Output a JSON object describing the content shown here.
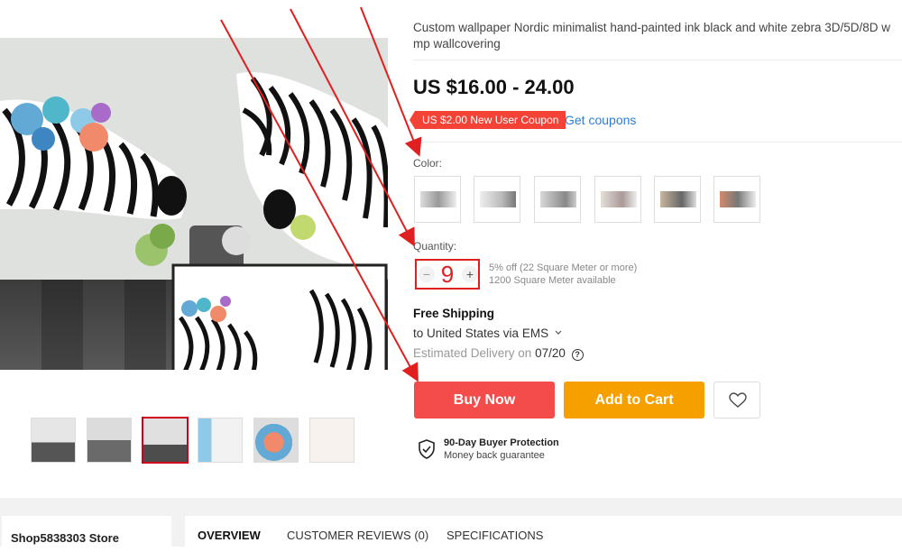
{
  "product": {
    "title_line1": "Custom wallpaper Nordic minimalist hand-painted ink black and white zebra 3D/5D/8D w",
    "title_line2": "mp wallcovering",
    "price": "US $16.00 - 24.00",
    "coupon_label": "US $2.00 New User Coupon",
    "get_coupons": "Get coupons"
  },
  "color": {
    "label": "Color:",
    "swatch_count": 6
  },
  "quantity": {
    "label": "Quantity:",
    "value": "9",
    "minus": "−",
    "plus": "+",
    "discount": "5% off (22 Square Meter or more)",
    "available": "1200 Square Meter available"
  },
  "shipping": {
    "title": "Free Shipping",
    "destination": "to United States via EMS",
    "estimate_prefix": "Estimated Delivery on",
    "estimate_date": "07/20",
    "help_glyph": "?"
  },
  "actions": {
    "buy_now": "Buy Now",
    "add_to_cart": "Add to Cart"
  },
  "protection": {
    "title": "90-Day Buyer Protection",
    "subtitle": "Money back guarantee"
  },
  "gallery": {
    "thumbnail_count": 6,
    "active_index": 2
  },
  "bottom": {
    "store_name": "Shop5838303 Store",
    "tabs": [
      "OVERVIEW",
      "CUSTOMER REVIEWS (0)",
      "SPECIFICATIONS"
    ]
  },
  "colors": {
    "accent_red": "#f44b4b",
    "accent_orange": "#f6a000",
    "link_blue": "#2e7dd7",
    "arrow_red": "#e02020"
  },
  "icons": {
    "wishlist": "heart-icon",
    "protection": "shield-check-icon",
    "help": "question-circle-icon",
    "dropdown": "chevron-down-icon"
  }
}
